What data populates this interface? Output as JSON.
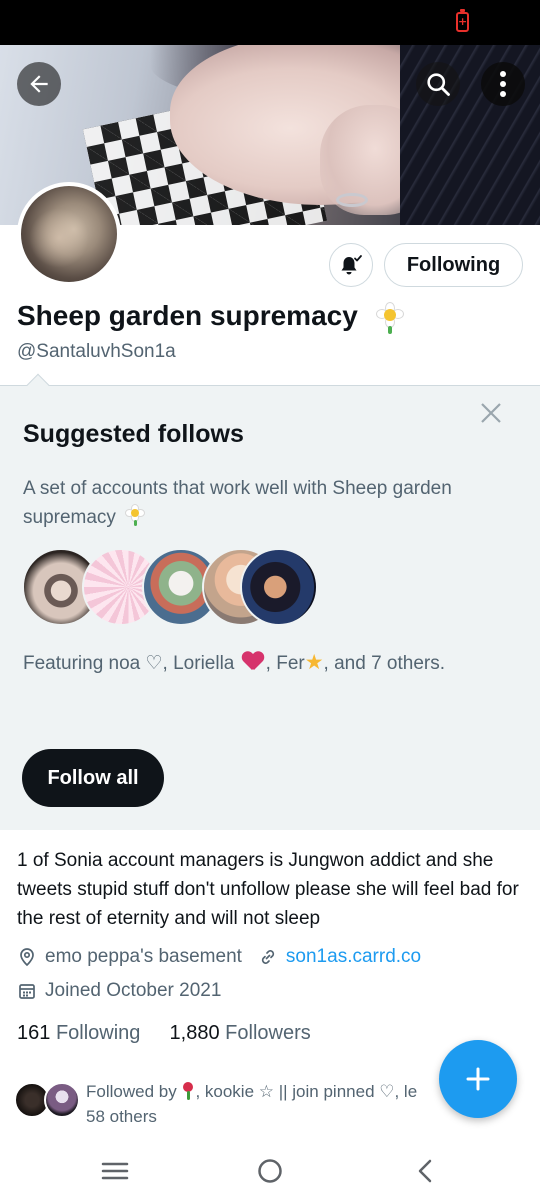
{
  "profile": {
    "display_name": "Sheep garden supremacy",
    "handle": "@SantaluvhSon1a",
    "following_button": "Following",
    "bio": "1 of Sonia account managers is Jungwon addict and she tweets stupid stuff don't unfollow please she will feel bad for the rest of eternity and will not sleep",
    "location": "emo peppa's basement",
    "website": "son1as.carrd.co",
    "joined": "Joined October 2021",
    "following_count": "161",
    "following_label": "Following",
    "followers_count": "1,880",
    "followers_label": "Followers"
  },
  "suggested": {
    "title": "Suggested follows",
    "description": "A set of accounts that work well with Sheep garden supremacy",
    "featuring_prefix": "Featuring noa ♡, Loriella",
    "featuring_middle": ", Fer",
    "featuring_suffix": ", and 7 others.",
    "follow_all": "Follow all"
  },
  "followed_by": {
    "prefix": "Followed by",
    "middle": ", kookie ☆ || join pinned ♡, le",
    "suffix": "58 others"
  },
  "icons": {
    "back": "arrow-left-icon",
    "search": "search-icon",
    "more": "more-vertical-icon",
    "notifications": "bell-icon",
    "close": "close-icon",
    "location": "location-pin-icon",
    "link": "link-icon",
    "calendar": "calendar-icon",
    "compose": "plus-icon",
    "battery": "battery-charging-icon"
  },
  "colors": {
    "accent": "#1d9bf0",
    "text": "#0f1419",
    "secondary_text": "#536471",
    "suggest_bg": "#eff3f4",
    "battery": "#e8302b"
  }
}
